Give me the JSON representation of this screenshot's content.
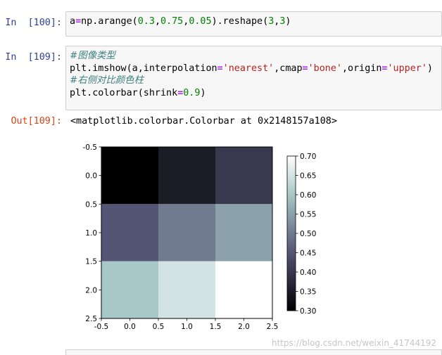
{
  "cells": [
    {
      "prompt": "In  [100]:",
      "lines": [
        [
          {
            "t": "nm",
            "s": "a"
          },
          {
            "t": "op",
            "s": "="
          },
          {
            "t": "nm",
            "s": "np.arange("
          },
          {
            "t": "num",
            "s": "0.3"
          },
          {
            "t": "nm",
            "s": ","
          },
          {
            "t": "num",
            "s": "0.75"
          },
          {
            "t": "nm",
            "s": ","
          },
          {
            "t": "num",
            "s": "0.05"
          },
          {
            "t": "nm",
            "s": ").reshape("
          },
          {
            "t": "num",
            "s": "3"
          },
          {
            "t": "nm",
            "s": ","
          },
          {
            "t": "num",
            "s": "3"
          },
          {
            "t": "nm",
            "s": ")"
          }
        ]
      ]
    },
    {
      "prompt": "In  [109]:",
      "lines": [
        [
          {
            "t": "cmt",
            "s": "#图像类型"
          }
        ],
        [
          {
            "t": "nm",
            "s": "plt.imshow(a,interpolation"
          },
          {
            "t": "op",
            "s": "="
          },
          {
            "t": "str",
            "s": "'nearest'"
          },
          {
            "t": "nm",
            "s": ",cmap"
          },
          {
            "t": "op",
            "s": "="
          },
          {
            "t": "str",
            "s": "'bone'"
          },
          {
            "t": "nm",
            "s": ",origin"
          },
          {
            "t": "op",
            "s": "="
          },
          {
            "t": "str",
            "s": "'upper'"
          },
          {
            "t": "nm",
            "s": ")"
          }
        ],
        [
          {
            "t": "cmt",
            "s": "#右侧对比颜色柱"
          }
        ],
        [
          {
            "t": "nm",
            "s": "plt.colorbar(shrink"
          },
          {
            "t": "op",
            "s": "="
          },
          {
            "t": "num",
            "s": "0.9"
          },
          {
            "t": "nm",
            "s": ")"
          }
        ]
      ]
    }
  ],
  "output": {
    "prompt": "Out[109]:",
    "text": "<matplotlib.colorbar.Colorbar at 0x2148157a108>"
  },
  "chart_data": {
    "type": "heatmap",
    "cmap": "bone",
    "origin": "upper",
    "interpolation": "nearest",
    "values": [
      [
        0.3,
        0.35,
        0.4
      ],
      [
        0.45,
        0.5,
        0.55
      ],
      [
        0.6,
        0.65,
        0.7
      ]
    ],
    "xlim": [
      -0.5,
      2.5
    ],
    "ylim": [
      2.5,
      -0.5
    ],
    "x_ticks": [
      "-0.5",
      "0.0",
      "0.5",
      "1.0",
      "1.5",
      "2.0",
      "2.5"
    ],
    "y_ticks": [
      "-0.5",
      "0.0",
      "0.5",
      "1.0",
      "1.5",
      "2.0",
      "2.5"
    ],
    "colorbar": {
      "range": [
        0.3,
        0.7
      ],
      "ticks": [
        "0.30",
        "0.35",
        "0.40",
        "0.45",
        "0.50",
        "0.55",
        "0.60",
        "0.65",
        "0.70"
      ]
    },
    "grid": false
  },
  "watermark": "https://blog.csdn.net/weixin_41744192"
}
